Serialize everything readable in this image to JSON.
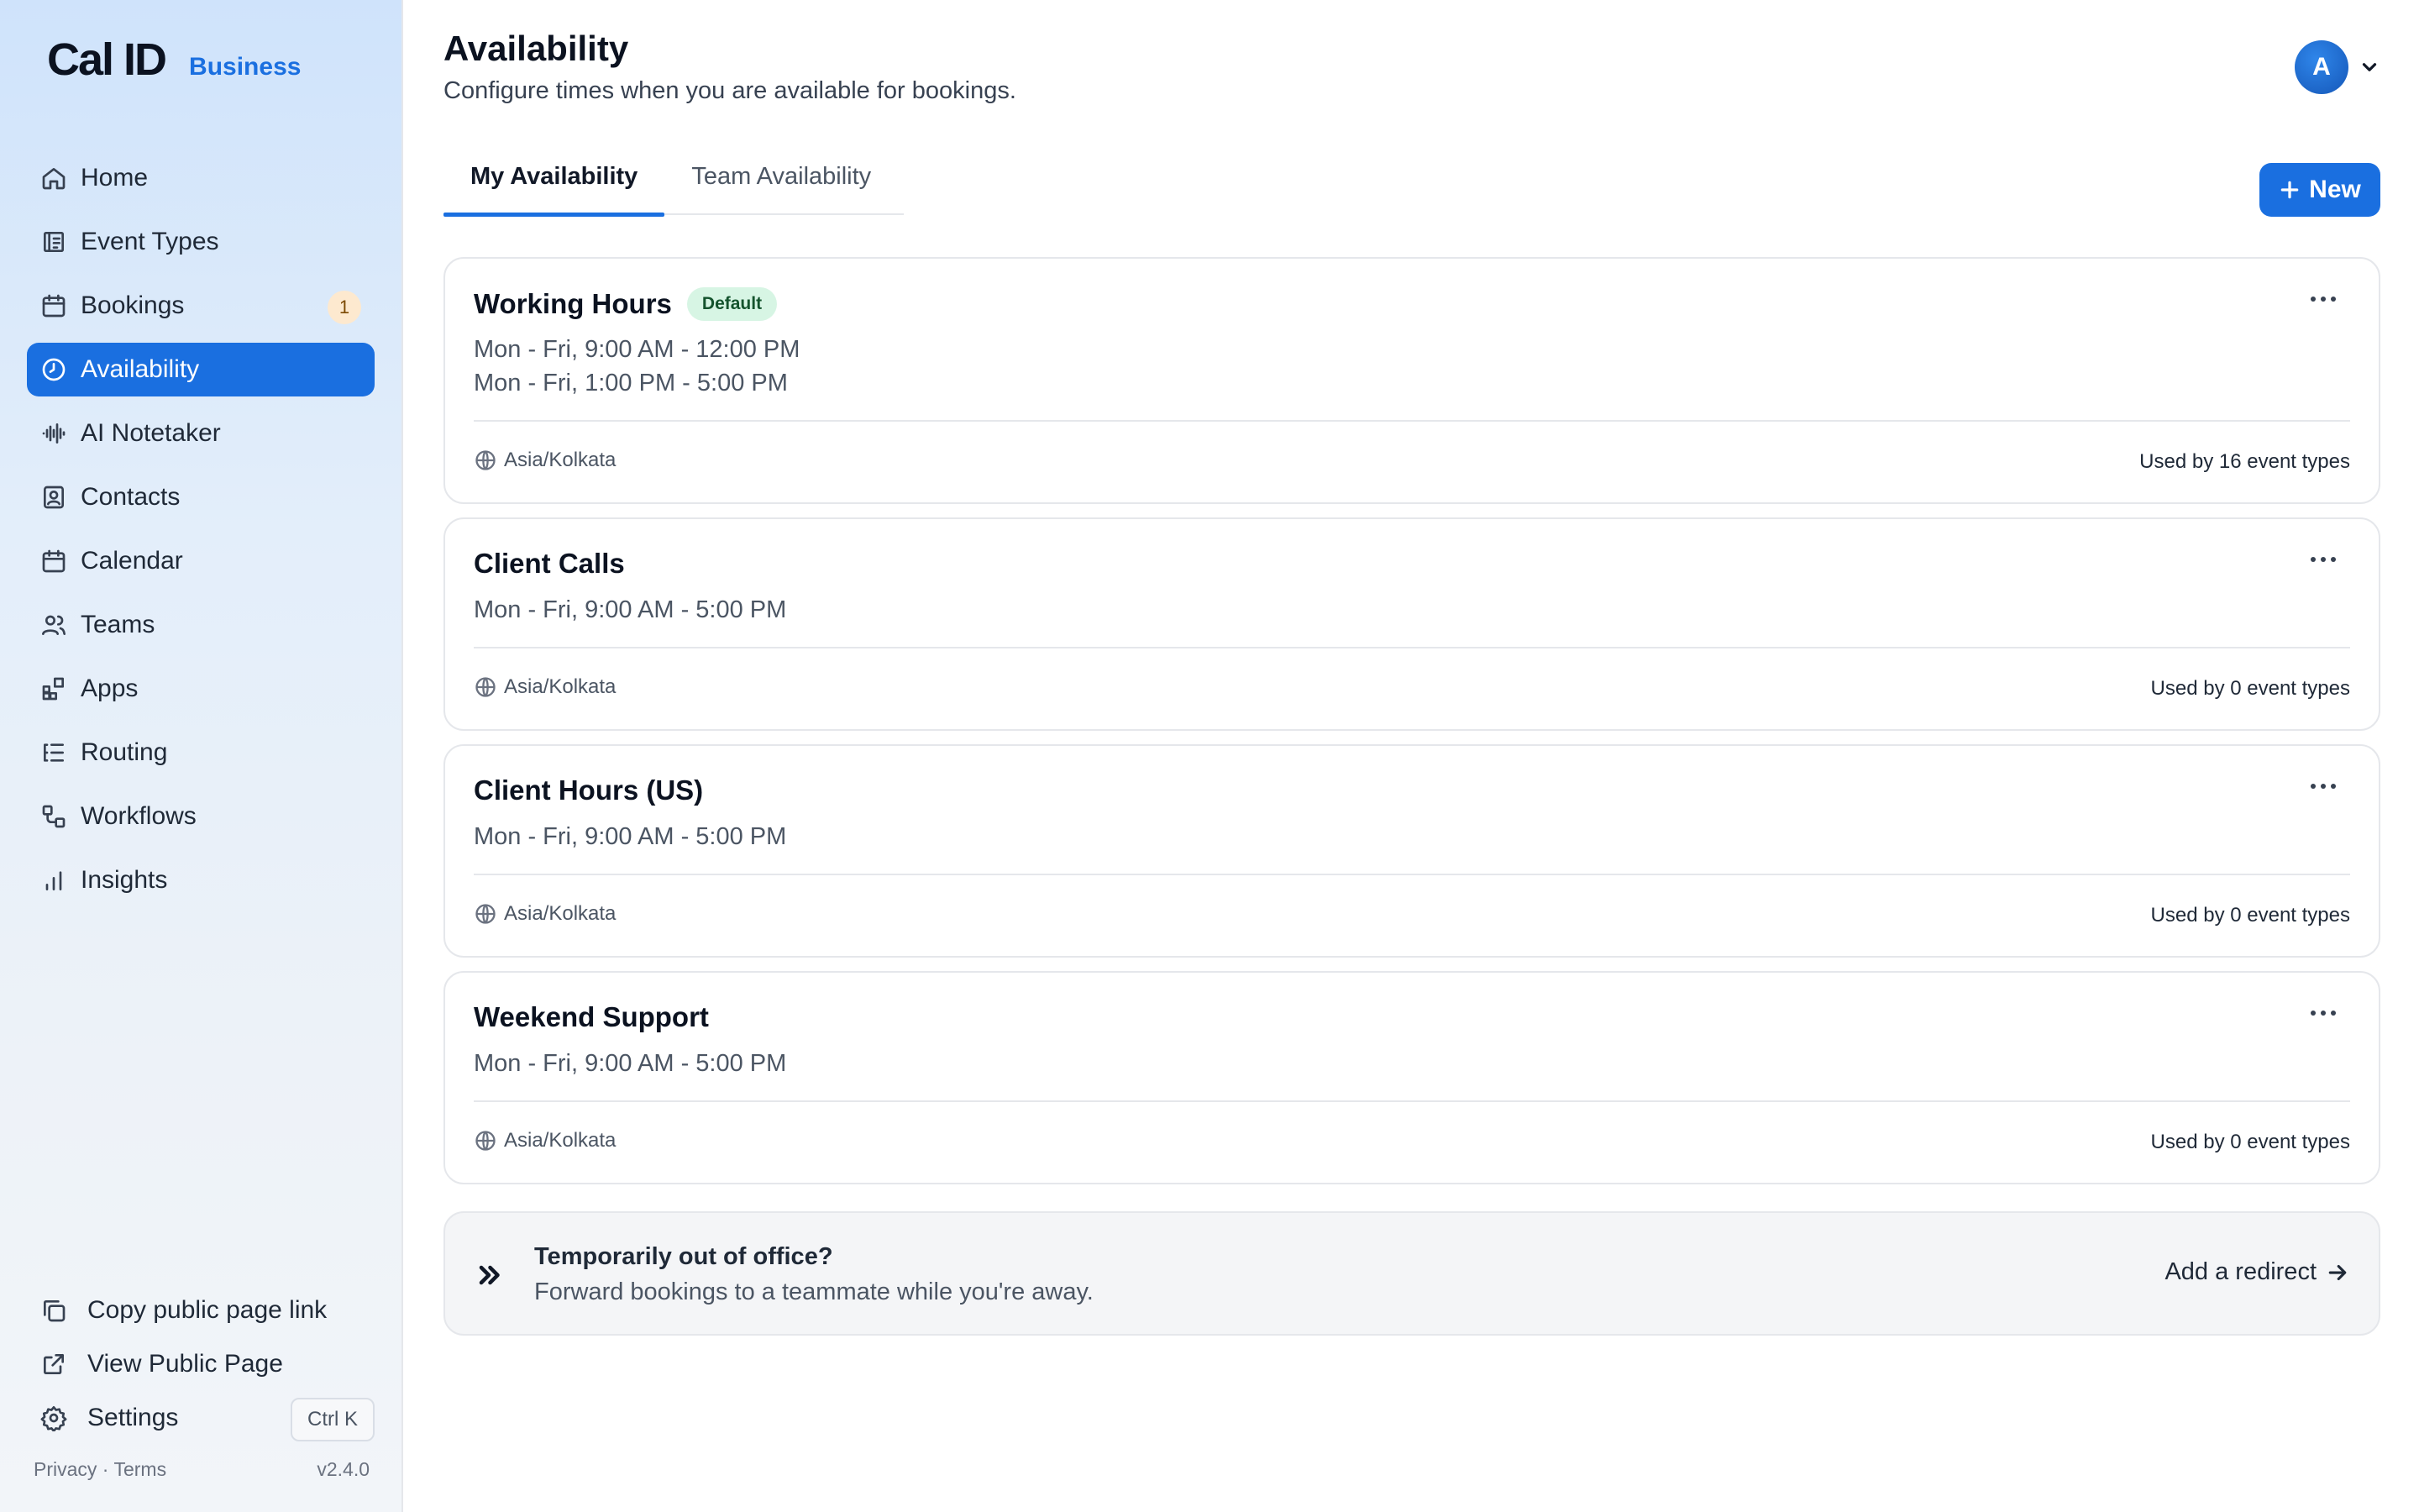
{
  "brand": {
    "logo": "Cal ID",
    "tag": "Business",
    "accent": "#1a6fe0"
  },
  "sidebar": {
    "items": [
      {
        "label": "Home",
        "icon": "home-icon"
      },
      {
        "label": "Event Types",
        "icon": "event-types-icon"
      },
      {
        "label": "Bookings",
        "icon": "calendar-icon",
        "badge": "1"
      },
      {
        "label": "Availability",
        "icon": "clock-icon",
        "active": true
      },
      {
        "label": "AI Notetaker",
        "icon": "waveform-icon"
      },
      {
        "label": "Contacts",
        "icon": "contacts-icon"
      },
      {
        "label": "Calendar",
        "icon": "calendar-icon"
      },
      {
        "label": "Teams",
        "icon": "users-icon"
      },
      {
        "label": "Apps",
        "icon": "grid-icon"
      },
      {
        "label": "Routing",
        "icon": "routing-icon"
      },
      {
        "label": "Workflows",
        "icon": "workflow-icon"
      },
      {
        "label": "Insights",
        "icon": "bar-chart-icon"
      }
    ],
    "bottom": {
      "copy_link": "Copy public page link",
      "view_public": "View Public Page",
      "settings": "Settings",
      "shortcut": "Ctrl K"
    },
    "footer": {
      "privacy": "Privacy",
      "sep": "·",
      "terms": "Terms",
      "version": "v2.4.0"
    }
  },
  "header": {
    "title": "Availability",
    "subtitle": "Configure times when you are available for bookings.",
    "avatar_letter": "A"
  },
  "tabs": [
    {
      "label": "My Availability",
      "active": true
    },
    {
      "label": "Team Availability",
      "active": false
    }
  ],
  "new_button": "New",
  "schedules": [
    {
      "name": "Working Hours",
      "badge": "Default",
      "lines": [
        "Mon - Fri, 9:00 AM - 12:00 PM",
        "Mon - Fri, 1:00 PM - 5:00 PM"
      ],
      "timezone": "Asia/Kolkata",
      "used_by": "Used by 16 event types"
    },
    {
      "name": "Client Calls",
      "lines": [
        "Mon - Fri, 9:00 AM - 5:00 PM"
      ],
      "timezone": "Asia/Kolkata",
      "used_by": "Used by 0 event types"
    },
    {
      "name": "Client Hours (US)",
      "lines": [
        "Mon - Fri, 9:00 AM - 5:00 PM"
      ],
      "timezone": "Asia/Kolkata",
      "used_by": "Used by 0 event types"
    },
    {
      "name": "Weekend Support",
      "lines": [
        "Mon - Fri, 9:00 AM - 5:00 PM"
      ],
      "timezone": "Asia/Kolkata",
      "used_by": "Used by 0 event types"
    }
  ],
  "out_of_office": {
    "title": "Temporarily out of office?",
    "subtitle": "Forward bookings to a teammate while you're away.",
    "link": "Add a redirect"
  }
}
